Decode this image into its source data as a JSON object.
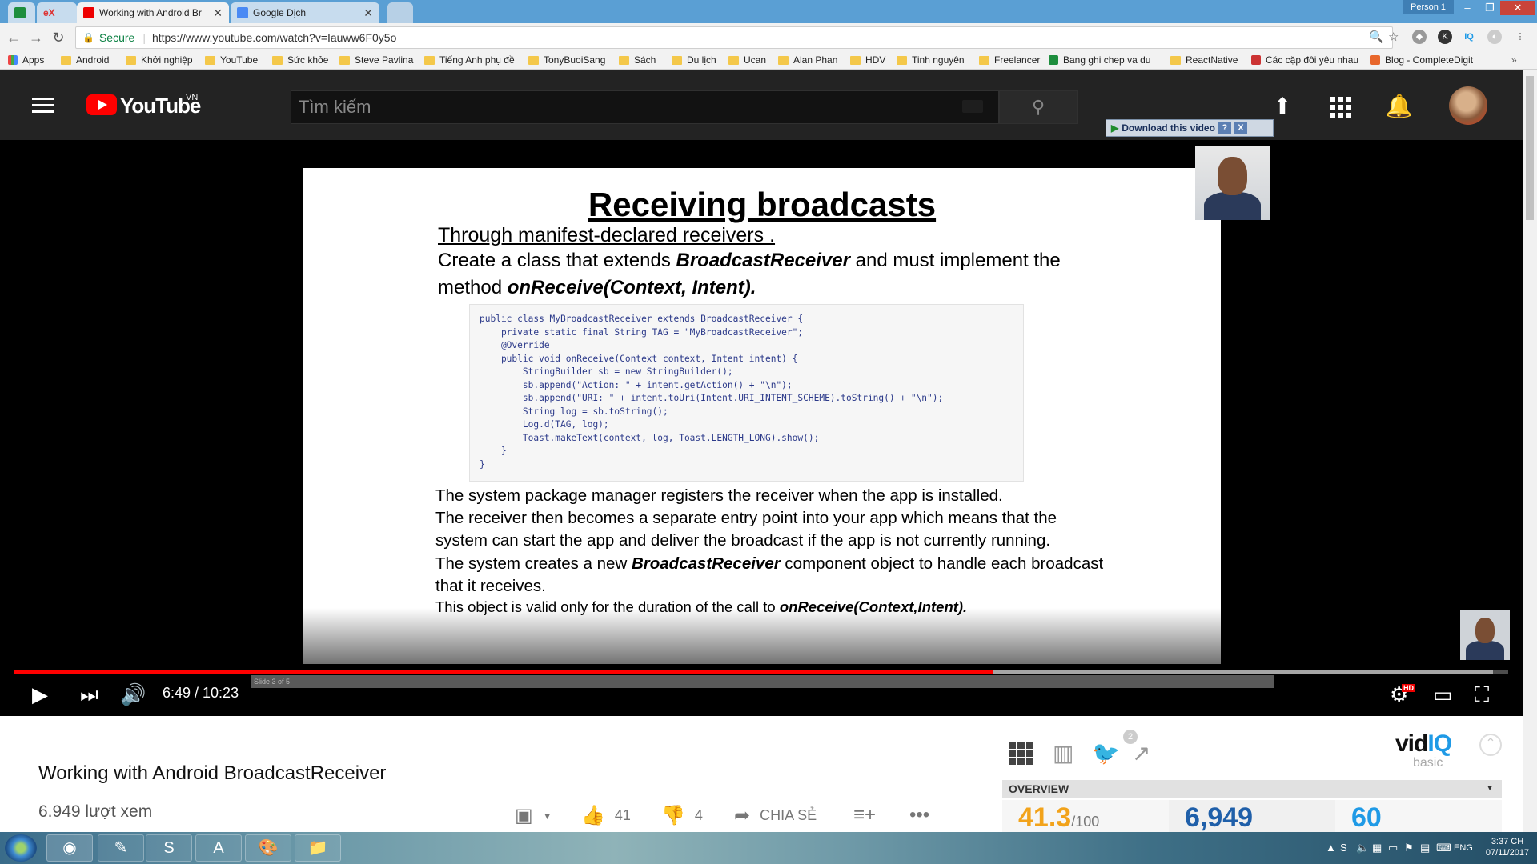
{
  "tabs": [
    {
      "label": "",
      "icon": "sheets-icon",
      "active": false
    },
    {
      "label": "eX",
      "icon": "",
      "active": false
    },
    {
      "label": "Working with Android Br",
      "icon": "youtube-icon",
      "active": true
    },
    {
      "label": "Google Dịch",
      "icon": "google-translate-icon",
      "active": false
    }
  ],
  "profile": "Person 1",
  "address_bar": {
    "secure_label": "Secure",
    "url": "https://www.youtube.com/watch?v=Iauww6F0y5o"
  },
  "bookmarks": [
    "Apps",
    "Android",
    "Khởi nghiệp",
    "YouTube",
    "Sức khỏe",
    "Steve Pavlina",
    "Tiếng Anh phụ đề",
    "TonyBuoiSang",
    "Sách",
    "Du lịch",
    "Ucan",
    "Alan Phan",
    "HDV",
    "Tinh nguyên",
    "Freelancer",
    "Bang ghi chep va du",
    "ReactNative",
    "Các cặp đôi yêu nhau",
    "Blog - CompleteDigit"
  ],
  "youtube": {
    "logo_text": "YouTube",
    "country": "VN",
    "search_placeholder": "Tìm kiếm"
  },
  "download_bar": {
    "label": "Download this video",
    "help": "?",
    "close": "X"
  },
  "slide": {
    "title": "Receiving broadcasts",
    "subtitle": "Through manifest-declared receivers .",
    "line1_pre": "Create a class that extends ",
    "line1_bold": "BroadcastReceiver",
    "line1_post": " and must implement the",
    "line2_pre": "method ",
    "line2_bold": "onReceive(Context, Intent).",
    "code": "public class MyBroadcastReceiver extends BroadcastReceiver {\n    private static final String TAG = \"MyBroadcastReceiver\";\n    @Override\n    public void onReceive(Context context, Intent intent) {\n        StringBuilder sb = new StringBuilder();\n        sb.append(\"Action: \" + intent.getAction() + \"\\n\");\n        sb.append(\"URI: \" + intent.toUri(Intent.URI_INTENT_SCHEME).toString() + \"\\n\");\n        String log = sb.toString();\n        Log.d(TAG, log);\n        Toast.makeText(context, log, Toast.LENGTH_LONG).show();\n    }\n}",
    "p1": "The system package manager registers the receiver when the app is installed.",
    "p2": "The receiver then becomes a separate entry point into your app which means that the",
    "p3": "system can start the app and deliver the broadcast if the app is not currently running.",
    "p4_pre": "The system creates a new ",
    "p4_bold": "BroadcastReceiver",
    "p4_post": " component object to handle each broadcast",
    "p5": "that it receives.",
    "p6_pre": "This object is valid only for the duration of the call to ",
    "p6_bold": "onReceive(Context,Intent).",
    "nav_label": "Slide 3 of 5"
  },
  "player": {
    "time": "6:49 / 10:23",
    "progress": 0.655,
    "buffered": 0.99,
    "hd_badge": "HD"
  },
  "video": {
    "title": "Working with Android BroadcastReceiver",
    "views": "6.949 lượt xem",
    "likes": "41",
    "dislikes": "4",
    "share_label": "CHIA SẺ"
  },
  "vidiq": {
    "logo_a": "vid",
    "logo_b": "IQ",
    "plan": "basic",
    "twitter_count": "2",
    "overview_label": "OVERVIEW",
    "score": "41.3",
    "score_max": "/100",
    "views": "6,949",
    "third": "60"
  },
  "taskbar": {
    "lang": "ENG",
    "time": "3:37 CH",
    "date": "07/11/2017"
  }
}
